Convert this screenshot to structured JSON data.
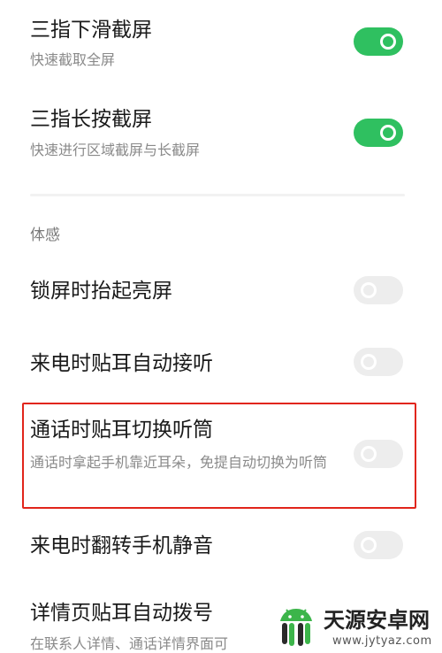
{
  "settings": {
    "three_finger_swipe": {
      "title": "三指下滑截屏",
      "subtitle": "快速截取全屏",
      "enabled": true
    },
    "three_finger_hold": {
      "title": "三指长按截屏",
      "subtitle": "快速进行区域截屏与长截屏",
      "enabled": true
    }
  },
  "section": {
    "header": "体感"
  },
  "gestures": {
    "raise_to_wake": {
      "title": "锁屏时抬起亮屏",
      "enabled": false
    },
    "auto_answer": {
      "title": "来电时贴耳自动接听",
      "enabled": false
    },
    "switch_receiver": {
      "title": "通话时贴耳切换听筒",
      "subtitle": "通话时拿起手机靠近耳朵，免提自动切换为听筒",
      "enabled": false
    },
    "flip_mute": {
      "title": "来电时翻转手机静音",
      "enabled": false
    },
    "auto_dial": {
      "title": "详情页贴耳自动拨号",
      "subtitle": "在联系人详情、通话详情界面可"
    }
  },
  "watermark": {
    "name": "天源安卓网",
    "url": "www.jytyaz.com",
    "colors": {
      "logo_green": "#3cb54a",
      "logo_dark": "#2a2a2a"
    }
  },
  "colors": {
    "toggle_on": "#2fc060",
    "toggle_off": "#ededed",
    "highlight": "#e1251b"
  }
}
